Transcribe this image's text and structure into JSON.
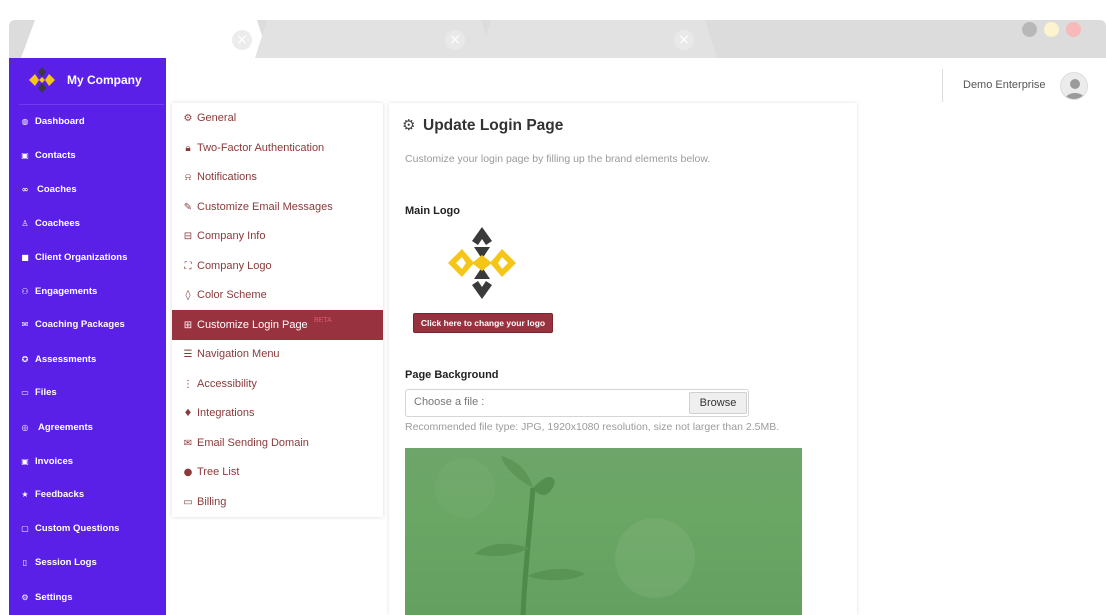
{
  "browser": {
    "tab_close_glyph": "×"
  },
  "sidebar": {
    "company_name": "My Company",
    "items": [
      {
        "label": "Dashboard",
        "icon": "dashboard-icon"
      },
      {
        "label": "Contacts",
        "icon": "contacts-icon"
      },
      {
        "label": "Coaches",
        "icon": "coaches-icon"
      },
      {
        "label": "Coachees",
        "icon": "coachees-icon"
      },
      {
        "label": "Client Organizations",
        "icon": "building-icon"
      },
      {
        "label": "Engagements",
        "icon": "users-icon"
      },
      {
        "label": "Coaching Packages",
        "icon": "package-icon"
      },
      {
        "label": "Assessments",
        "icon": "assessment-icon"
      },
      {
        "label": "Files",
        "icon": "folder-icon"
      },
      {
        "label": "Agreements",
        "icon": "handshake-icon"
      },
      {
        "label": "Invoices",
        "icon": "invoice-icon"
      },
      {
        "label": "Feedbacks",
        "icon": "star-icon"
      },
      {
        "label": "Custom Questions",
        "icon": "question-icon"
      },
      {
        "label": "Session Logs",
        "icon": "log-icon"
      },
      {
        "label": "Settings",
        "icon": "gear-icon"
      }
    ]
  },
  "settings_menu": {
    "items": [
      {
        "label": "General",
        "icon": "gear-icon"
      },
      {
        "label": "Two-Factor Authentication",
        "icon": "lock-icon"
      },
      {
        "label": "Notifications",
        "icon": "bell-icon"
      },
      {
        "label": "Customize Email Messages",
        "icon": "pencil-icon"
      },
      {
        "label": "Company Info",
        "icon": "briefcase-icon"
      },
      {
        "label": "Company Logo",
        "icon": "frame-icon"
      },
      {
        "label": "Color Scheme",
        "icon": "drop-icon"
      },
      {
        "label": "Customize Login Page",
        "icon": "login-icon",
        "badge": "BETA",
        "active": true
      },
      {
        "label": "Navigation Menu",
        "icon": "hamburger-icon"
      },
      {
        "label": "Accessibility",
        "icon": "dots-icon"
      },
      {
        "label": "Integrations",
        "icon": "plug-icon"
      },
      {
        "label": "Email Sending Domain",
        "icon": "envelope-icon"
      },
      {
        "label": "Tree List",
        "icon": "tree-icon"
      },
      {
        "label": "Billing",
        "icon": "card-icon"
      }
    ]
  },
  "main": {
    "title": "Update Login Page",
    "subtitle": "Customize your login page by filling up the brand elements below.",
    "main_logo_label": "Main Logo",
    "change_logo_button": "Click here to change your logo",
    "page_background_label": "Page Background",
    "file_placeholder": "Choose a file :",
    "browse_label": "Browse",
    "hint": "Recommended file type: JPG, 1920x1080 resolution, size not larger than 2.5MB."
  },
  "header": {
    "user_name": "Demo Enterprise"
  },
  "colors": {
    "sidebar": "#5a20e8",
    "accent": "#98323f",
    "menu_text": "#8b3a3a",
    "window_dots": [
      "#b8b8b8",
      "#fbf4cf",
      "#f7b9b9"
    ]
  }
}
